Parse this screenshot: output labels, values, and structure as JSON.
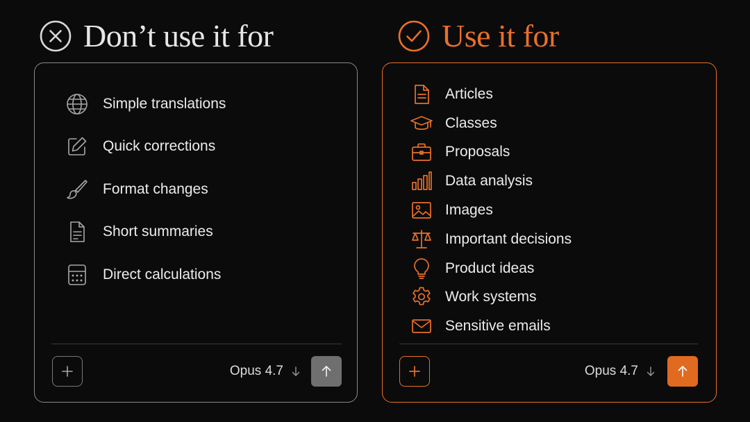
{
  "colors": {
    "background": "#0b0b0b",
    "neutral_border": "#8a8a8a",
    "accent": "#e8702a",
    "text": "#ececec",
    "send_neutral": "#6f6f6f",
    "send_accent": "#e06a20"
  },
  "left": {
    "heading": "Don’t use it for",
    "heading_icon": "x-circle-icon",
    "items": [
      {
        "label": "Simple translations",
        "icon": "globe-icon"
      },
      {
        "label": "Quick corrections",
        "icon": "edit-icon"
      },
      {
        "label": "Format changes",
        "icon": "brush-icon"
      },
      {
        "label": "Short summaries",
        "icon": "document-icon"
      },
      {
        "label": "Direct calculations",
        "icon": "calculator-icon"
      }
    ],
    "composer": {
      "add_icon": "plus-icon",
      "model_label": "Opus 4.7",
      "model_icon": "arrow-down-icon",
      "send_icon": "arrow-up-icon"
    }
  },
  "right": {
    "heading": "Use it for",
    "heading_icon": "check-circle-icon",
    "items": [
      {
        "label": "Articles",
        "icon": "document-icon"
      },
      {
        "label": "Classes",
        "icon": "graduation-cap-icon"
      },
      {
        "label": "Proposals",
        "icon": "briefcase-icon"
      },
      {
        "label": "Data analysis",
        "icon": "bar-chart-icon"
      },
      {
        "label": "Images",
        "icon": "image-icon"
      },
      {
        "label": "Important decisions",
        "icon": "scale-icon"
      },
      {
        "label": "Product ideas",
        "icon": "lightbulb-icon"
      },
      {
        "label": "Work systems",
        "icon": "gear-icon"
      },
      {
        "label": "Sensitive emails",
        "icon": "mail-icon"
      }
    ],
    "composer": {
      "add_icon": "plus-icon",
      "model_label": "Opus 4.7",
      "model_icon": "arrow-down-icon",
      "send_icon": "arrow-up-icon"
    }
  }
}
